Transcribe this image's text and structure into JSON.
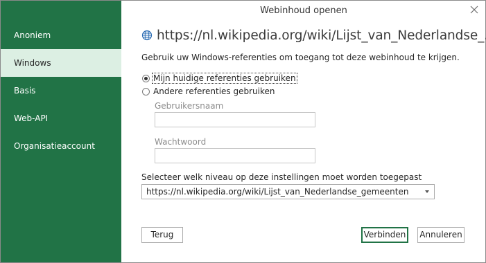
{
  "dialog": {
    "title": "Webinhoud openen",
    "close_icon": "close-icon"
  },
  "sidebar": {
    "items": [
      {
        "label": "Anoniem",
        "selected": false
      },
      {
        "label": "Windows",
        "selected": true
      },
      {
        "label": "Basis",
        "selected": false
      },
      {
        "label": "Web-API",
        "selected": false
      },
      {
        "label": "Organisatieaccount",
        "selected": false
      }
    ],
    "background": "#217346",
    "selected_background": "#dcefe3"
  },
  "main": {
    "url_icon": "globe-icon",
    "url": "https://nl.wikipedia.org/wiki/Lijst_van_Nederlandse_...",
    "description": "Gebruik uw Windows-referenties om toegang tot deze webinhoud te krijgen.",
    "options": [
      {
        "label": "Mijn huidige referenties gebruiken",
        "checked": true
      },
      {
        "label": "Andere referenties gebruiken",
        "checked": false
      }
    ],
    "username_label": "Gebruikersnaam",
    "username_value": "",
    "password_label": "Wachtwoord",
    "password_value": "",
    "level_label": "Selecteer welk niveau op deze instellingen moet worden toegepast",
    "level_selected": "https://nl.wikipedia.org/wiki/Lijst_van_Nederlandse_gemeenten"
  },
  "buttons": {
    "back": "Terug",
    "connect": "Verbinden",
    "cancel": "Annuleren"
  }
}
